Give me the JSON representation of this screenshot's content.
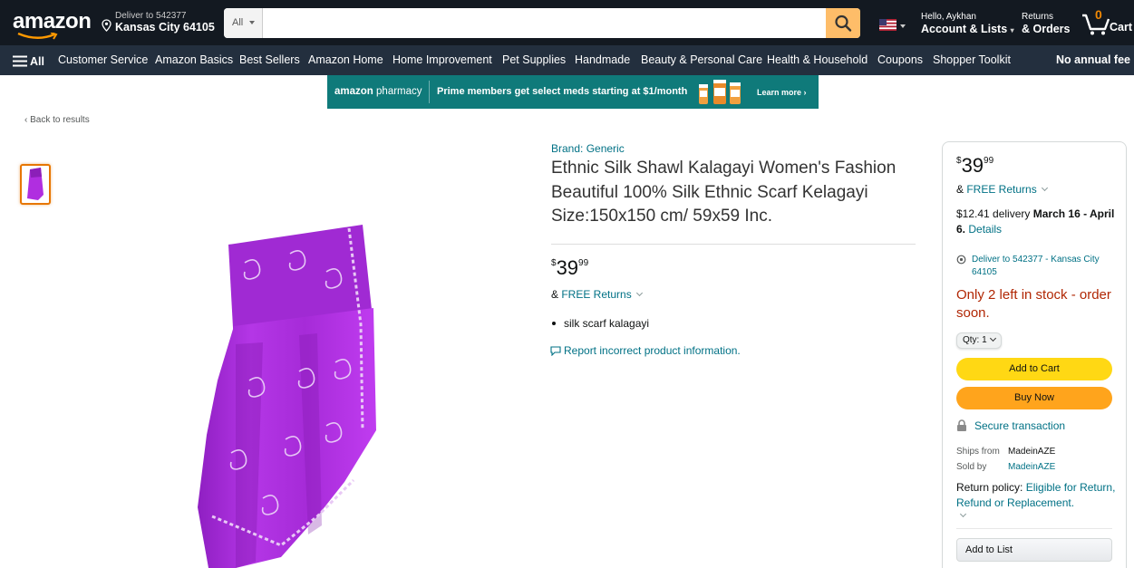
{
  "header": {
    "logo": "amazon",
    "deliver_line1": "Deliver to 542377",
    "deliver_line2": "Kansas City 64105",
    "search_category": "All",
    "search_placeholder": "",
    "account_line1": "Hello, Aykhan",
    "account_line2": "Account & Lists",
    "returns_line1": "Returns",
    "returns_line2": "& Orders",
    "cart_count": "0",
    "cart_label": "Cart"
  },
  "subnav": {
    "all_label": "All",
    "items": [
      "Customer Service",
      "Amazon Basics",
      "Best Sellers",
      "Amazon Home",
      "Home Improvement",
      "Pet Supplies",
      "Handmade",
      "Beauty & Personal Care",
      "Health & Household",
      "Coupons",
      "Shopper Toolkit"
    ],
    "promo": "No annual fee"
  },
  "banner": {
    "brand_bold": "amazon",
    "brand_rest": " pharmacy",
    "message": "Prime members get select meds starting at $1/month",
    "cta": "Learn more ›"
  },
  "back_link": "‹ Back to results",
  "product": {
    "brand": "Brand: Generic",
    "title": "Ethnic Silk Shawl Kalagayi Women's Fashion Beautiful 100% Silk Ethnic Scarf Kelagayi Size:150x150 cm/ 59x59 Inc.",
    "price_symbol": "$",
    "price_whole": "39",
    "price_fraction": "99",
    "returns_prefix": "& ",
    "returns_link": "FREE Returns",
    "bullets": [
      "silk scarf kalagayi"
    ],
    "report_link": "Report incorrect product information."
  },
  "buybox": {
    "price_symbol": "$",
    "price_whole": "39",
    "price_fraction": "99",
    "returns_prefix": "& ",
    "returns_link": "FREE Returns",
    "delivery_prefix": "$12.41 delivery ",
    "delivery_dates": "March 16 - April 6.",
    "delivery_details": "Details",
    "deliver_to": "Deliver to 542377 - Kansas City 64105",
    "stock": "Only 2 left in stock - order soon.",
    "qty_label": "Qty:",
    "qty_value": "1",
    "add_to_cart": "Add to Cart",
    "buy_now": "Buy Now",
    "secure": "Secure transaction",
    "ships_from_label": "Ships from",
    "ships_from_value": "MadeinAZE",
    "sold_by_label": "Sold by",
    "sold_by_value": "MadeinAZE",
    "policy_label": "Return policy: ",
    "policy_link": "Eligible for Return, Refund or Replacement.",
    "add_to_list": "Add to List"
  },
  "colors": {
    "nav_bg": "#131921",
    "subnav_bg": "#232f3e",
    "accent": "#febd69",
    "link": "#007185",
    "stock": "#b12704",
    "add_to_cart": "#ffd814",
    "buy_now": "#ffa41c",
    "scarf": "#b02ee0"
  }
}
